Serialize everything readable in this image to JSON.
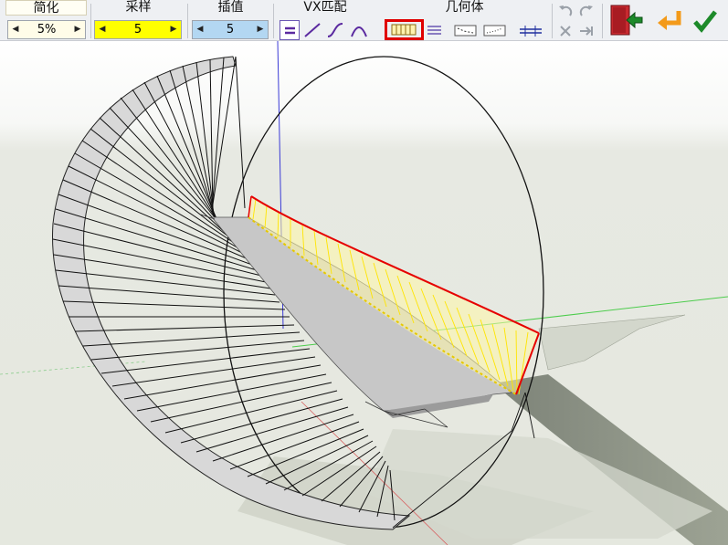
{
  "toolbar": {
    "simplify": {
      "title": "简化",
      "value": "5%"
    },
    "sample": {
      "title": "采样",
      "value": "5"
    },
    "interpolate": {
      "title": "插值",
      "value": "5"
    },
    "vx_match": {
      "title": "VX匹配"
    },
    "geometry": {
      "title": "几何体"
    }
  },
  "colors": {
    "sample_field": "#ffff00",
    "interpolate_field": "#b3d7f2",
    "simplify_field": "#fffce8",
    "highlight_box": "#e00000",
    "accent_red": "#c8292f",
    "accent_orange": "#f39a1a",
    "accent_green": "#1d8a2a",
    "surface_yellow": "#ffe500"
  },
  "icons": [
    "parallel-lines-icon",
    "straight-line-icon",
    "s-curve-icon",
    "arc-icon",
    "vertical-bars-icon",
    "horizontal-lines-icon",
    "dashed-rectangle-icon",
    "dotted-rectangle-icon",
    "double-line-icon",
    "undo-icon",
    "redo-icon",
    "cancel-icon",
    "skip-to-end-icon",
    "exit-door-icon",
    "return-icon",
    "checkmark-icon"
  ]
}
